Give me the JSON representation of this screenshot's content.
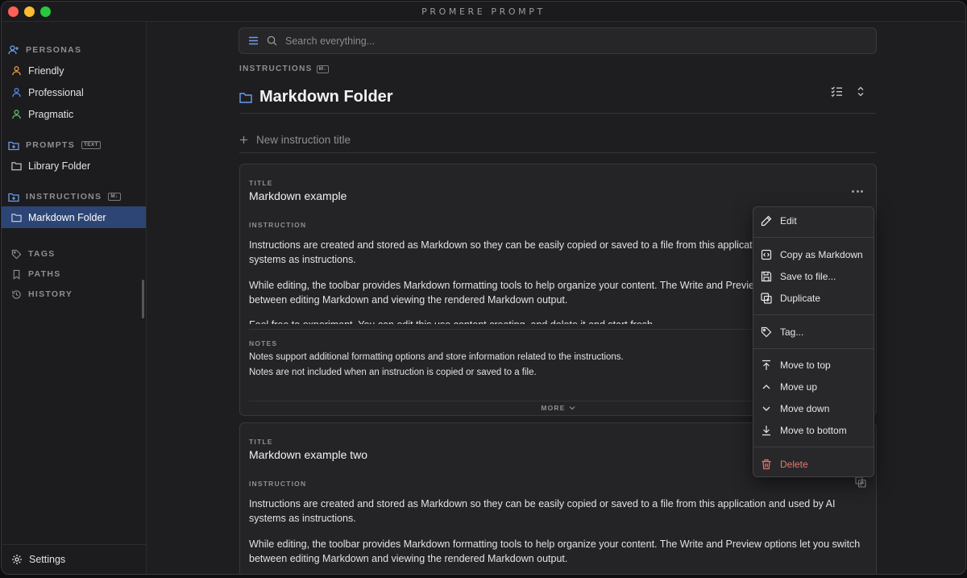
{
  "app": {
    "title": "PROMERE  PROMPT"
  },
  "sidebar": {
    "sections": {
      "personas": "PERSONAS",
      "prompts": "PROMPTS",
      "prompts_badge": "TEXT",
      "instructions": "INSTRUCTIONS",
      "instructions_badge": "M↓",
      "tags": "TAGS",
      "paths": "PATHS",
      "history": "HISTORY"
    },
    "personas": [
      "Friendly",
      "Professional",
      "Pragmatic"
    ],
    "persona_colors": [
      "#f0a04b",
      "#5b8def",
      "#5cc96b"
    ],
    "prompts": [
      "Library Folder"
    ],
    "instructions": [
      "Markdown Folder"
    ],
    "settings": "Settings"
  },
  "search": {
    "placeholder": "Search everything..."
  },
  "header": {
    "breadcrumb": "INSTRUCTIONS",
    "breadcrumb_badge": "M↓",
    "title": "Markdown Folder"
  },
  "new_instruction": {
    "placeholder": "New instruction title"
  },
  "cards": [
    {
      "title_label": "TITLE",
      "title": "Markdown example",
      "instruction_label": "INSTRUCTION",
      "paragraphs": [
        "Instructions are created and stored as Markdown so they can be easily copied or saved to a file from this application and used by AI systems as instructions.",
        "While editing, the toolbar provides Markdown formatting tools to help organize your content. The Write and Preview options let you switch between editing Markdown and viewing the rendered Markdown output.",
        "Feel free to experiment. You can edit this use content creating, and delete it and start fresh."
      ],
      "notes_label": "NOTES",
      "notes": [
        "Notes support additional formatting options and store information related to the instructions.",
        "Notes are not included when an instruction is copied or saved to a file."
      ],
      "more_label": "MORE"
    },
    {
      "title_label": "TITLE",
      "title": "Markdown example two",
      "instruction_label": "INSTRUCTION",
      "paragraphs": [
        "Instructions are created and stored as Markdown so they can be easily copied or saved to a file from this application and used by AI systems as instructions.",
        "While editing, the toolbar provides Markdown formatting tools to help organize your content. The Write and Preview options let you switch between editing Markdown and viewing the rendered Markdown output."
      ]
    }
  ],
  "menu": {
    "edit": "Edit",
    "copy_markdown": "Copy as Markdown",
    "save_file": "Save to file...",
    "duplicate": "Duplicate",
    "tag": "Tag...",
    "move_top": "Move to top",
    "move_up": "Move up",
    "move_down": "Move down",
    "move_bottom": "Move to bottom",
    "delete": "Delete"
  },
  "colors": {
    "accent": "#2d4574",
    "danger": "#e8776e",
    "search_icon": "#6f9bea"
  }
}
